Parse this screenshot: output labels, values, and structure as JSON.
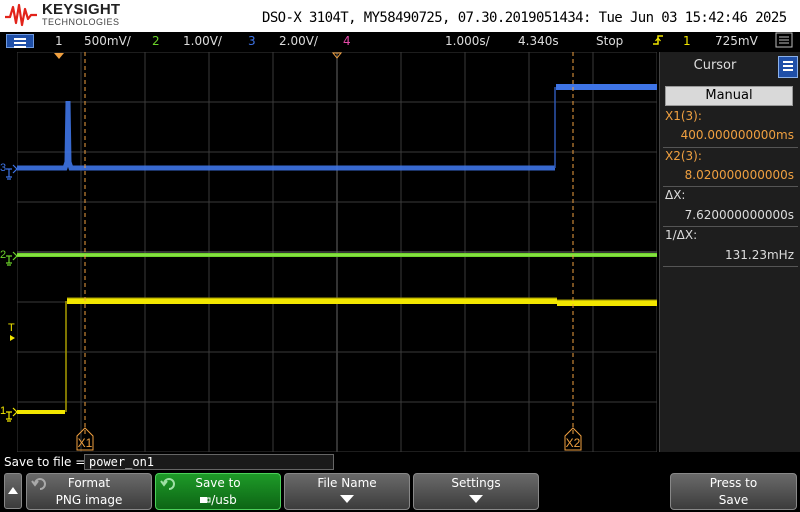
{
  "header": {
    "brand": "KEYSIGHT",
    "brand_sub": "TECHNOLOGIES",
    "scope_info": "DSO-X 3104T, MY58490725, 07.30.2019051434: Tue Jun 03 15:42:46 2025"
  },
  "status": {
    "ch1_num": "1",
    "ch1_scale": "500mV/",
    "ch2_num": "2",
    "ch2_scale": "1.00V/",
    "ch3_num": "3",
    "ch3_scale": "2.00V/",
    "ch4_num": "4",
    "timebase": "1.000s/",
    "delay": "4.340s",
    "run_state": "Stop",
    "trig_channel": "1",
    "trig_level": "725mV"
  },
  "colors": {
    "ch1": "#f2e600",
    "ch2": "#6cd42a",
    "ch3": "#3e74e6",
    "ch4": "#e44aa8",
    "cursor": "#f0a040",
    "accent": "#1f4fa8"
  },
  "markers": {
    "ch3": "3",
    "ch2": "2",
    "ch1": "1",
    "trigger": "T",
    "x1": "X1",
    "x2": "X2"
  },
  "side_panel": {
    "title": "Cursor",
    "mode": "Manual",
    "x1_label": "X1(3):",
    "x1_value": "400.000000000ms",
    "x2_label": "X2(3):",
    "x2_value": "8.020000000000s",
    "dx_label": "ΔX:",
    "dx_value": "7.620000000000s",
    "inv_dx_label": "1/ΔX:",
    "inv_dx_value": "131.23mHz"
  },
  "bottom": {
    "save_label": "Save to file =",
    "file_name": "power_on1",
    "softkeys": [
      {
        "line1": "Format",
        "line2": "PNG image"
      },
      {
        "line1": "Save to",
        "line2": "/usb"
      },
      {
        "line1": "File Name",
        "line2": ""
      },
      {
        "line1": "Settings",
        "line2": ""
      },
      {
        "line1": "Press to",
        "line2": "Save"
      }
    ]
  },
  "icons": [
    "keysight-logo-icon",
    "menu-icon",
    "trigger-edge-icon",
    "side-menu-icon",
    "up-arrow-icon",
    "undo-icon",
    "usb-icon",
    "down-arrow-icon"
  ]
}
